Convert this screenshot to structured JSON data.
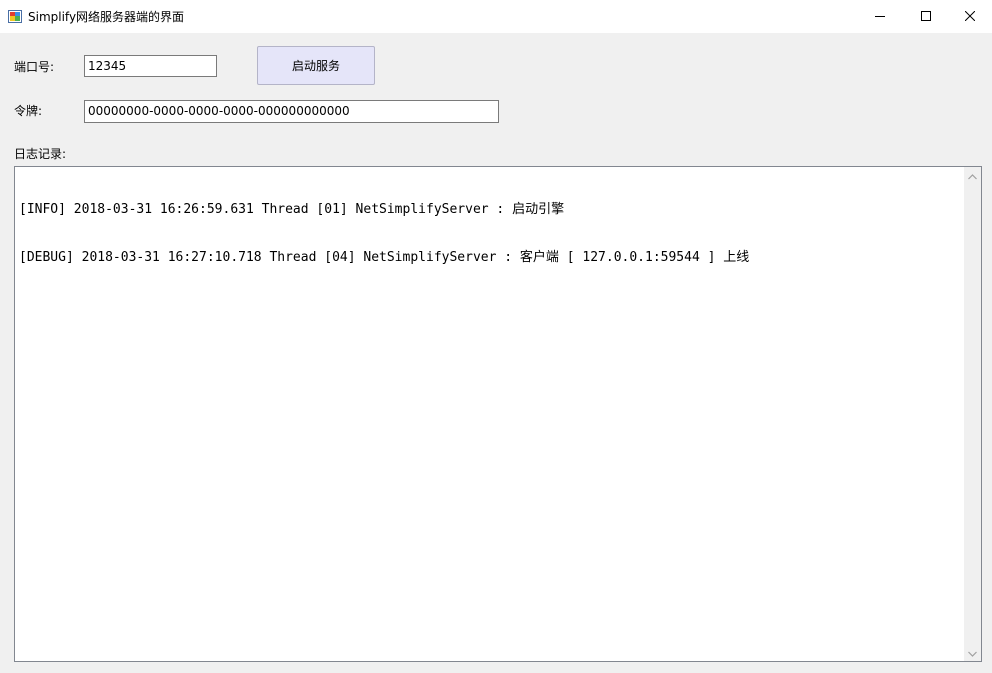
{
  "window": {
    "title": "Simplify网络服务器端的界面",
    "icon": "app-window-icon",
    "controls": [
      "minimize-icon",
      "maximize-icon",
      "close-icon"
    ]
  },
  "form": {
    "port_label": "端口号:",
    "port_value": "12345",
    "start_button_label": "启动服务",
    "token_label": "令牌:",
    "token_value": "00000000-0000-0000-0000-000000000000",
    "log_label": "日志记录:"
  },
  "log": {
    "lines": [
      "[INFO] 2018-03-31 16:26:59.631 Thread [01] NetSimplifyServer : 启动引擎",
      "[DEBUG] 2018-03-31 16:27:10.718 Thread [04] NetSimplifyServer : 客户端 [ 127.0.0.1:59544 ] 上线"
    ]
  },
  "colors": {
    "client_bg": "#f0f0f0",
    "button_bg": "#e5e5f9",
    "border": "#7a7a7a"
  }
}
